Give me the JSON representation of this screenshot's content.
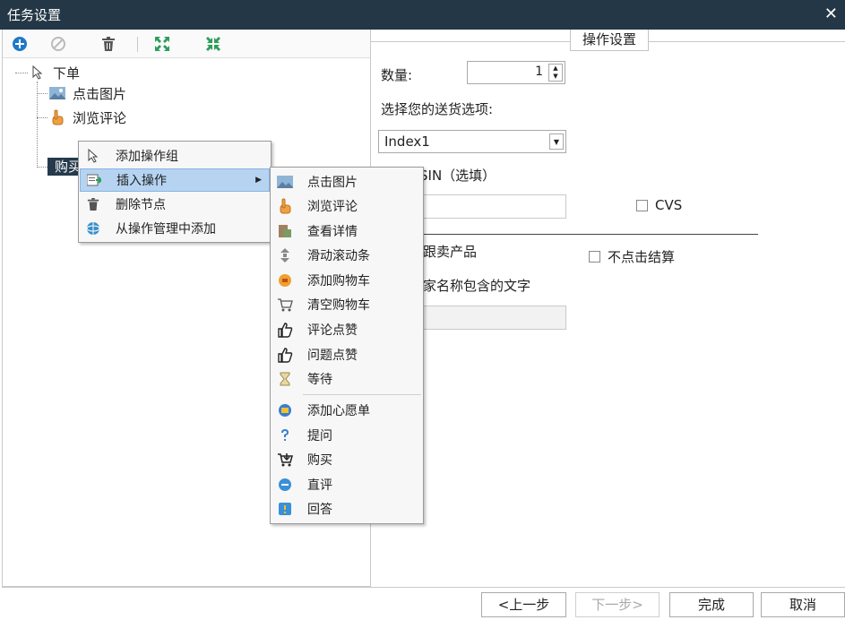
{
  "window": {
    "title": "任务设置",
    "close_glyph": "✕"
  },
  "toolbar": {
    "buttons": [
      {
        "icon": "add-circle-icon",
        "color": "#1e78c8"
      },
      {
        "icon": "disabled-circle-icon",
        "color": "#bbbbbb"
      },
      {
        "icon": "trash-icon",
        "color": "#555555"
      },
      {
        "icon": "expand-icon",
        "color": "#2e9e5a"
      },
      {
        "icon": "collapse-icon",
        "color": "#2e9e5a"
      }
    ]
  },
  "tree": {
    "root": {
      "label": "下单",
      "icon": "cursor-icon"
    },
    "children": [
      {
        "label": "点击图片",
        "icon": "image-icon"
      },
      {
        "label": "浏览评论",
        "icon": "hand-icon"
      },
      {
        "label": "购买",
        "icon": "cart-icon",
        "selected": true
      }
    ]
  },
  "context_menu": {
    "items": [
      {
        "label": "添加操作组",
        "icon": "cursor-icon"
      },
      {
        "label": "插入操作",
        "icon": "insert-icon",
        "submenu": true,
        "highlighted": true
      },
      {
        "label": "删除节点",
        "icon": "trash-icon"
      },
      {
        "label": "从操作管理中添加",
        "icon": "globe-icon"
      }
    ],
    "submenu_glyph": "▶"
  },
  "submenu": {
    "items": [
      {
        "label": "点击图片",
        "icon": "image-icon"
      },
      {
        "label": "浏览评论",
        "icon": "hand-icon"
      },
      {
        "label": "查看详情",
        "icon": "details-icon"
      },
      {
        "label": "滑动滚动条",
        "icon": "scroll-icon"
      },
      {
        "label": "添加购物车",
        "icon": "add-cart-icon"
      },
      {
        "label": "清空购物车",
        "icon": "empty-cart-icon"
      },
      {
        "label": "评论点赞",
        "icon": "thumbs-up-icon"
      },
      {
        "label": "问题点赞",
        "icon": "thumbs-up-icon"
      },
      {
        "label": "等待",
        "icon": "hourglass-icon"
      },
      {
        "label": "添加心愿单",
        "icon": "wishlist-icon"
      },
      {
        "label": "提问",
        "icon": "question-icon"
      },
      {
        "label": "购买",
        "icon": "buy-icon"
      },
      {
        "label": "直评",
        "icon": "comment-icon"
      },
      {
        "label": "回答",
        "icon": "answer-icon"
      }
    ]
  },
  "settings": {
    "tab_label": "操作设置",
    "quantity_label": "数量:",
    "quantity_value": "1",
    "delivery_label": "选择您的送货选项:",
    "delivery_selected": "Index1",
    "asin_label": "SIN（选填）",
    "cvs_label": "CVS",
    "follow_label": "跟卖产品",
    "no_checkout_label": "不点击结算",
    "seller_label": "家名称包含的文字"
  },
  "footer": {
    "prev": "<上一步",
    "next": "下一步>",
    "finish": "完成",
    "cancel": "取消"
  }
}
